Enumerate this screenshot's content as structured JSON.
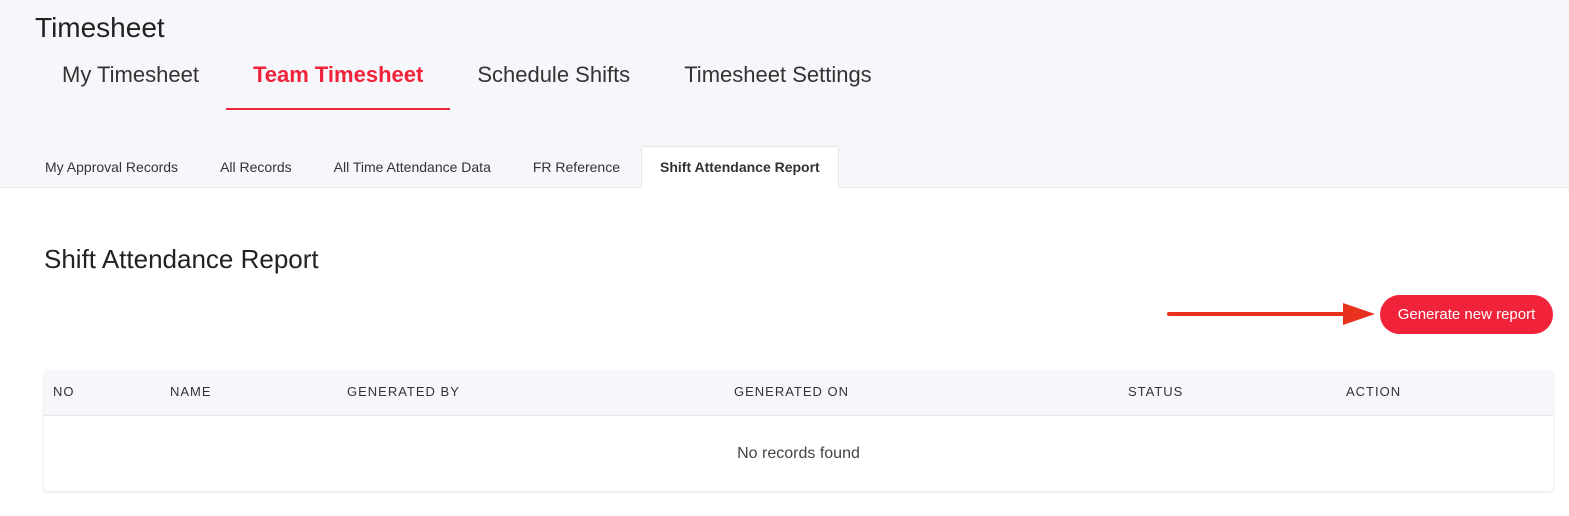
{
  "app": {
    "title": "Timesheet"
  },
  "main_tabs": [
    {
      "label": "My Timesheet",
      "active": false
    },
    {
      "label": "Team Timesheet",
      "active": true
    },
    {
      "label": "Schedule Shifts",
      "active": false
    },
    {
      "label": "Timesheet Settings",
      "active": false
    }
  ],
  "sub_tabs": [
    {
      "label": "My Approval Records",
      "active": false
    },
    {
      "label": "All Records",
      "active": false
    },
    {
      "label": "All Time Attendance Data",
      "active": false
    },
    {
      "label": "FR Reference",
      "active": false
    },
    {
      "label": "Shift Attendance Report",
      "active": true
    }
  ],
  "report": {
    "title": "Shift Attendance Report",
    "generate_button_label": "Generate new report"
  },
  "table": {
    "columns": [
      "NO",
      "NAME",
      "GENERATED BY",
      "GENERATED ON",
      "STATUS",
      "ACTION"
    ],
    "empty_message": "No records found"
  },
  "colors": {
    "accent": "#f0233a",
    "annotation_arrow": "#e8321e",
    "header_background": "#f6f7fa"
  }
}
